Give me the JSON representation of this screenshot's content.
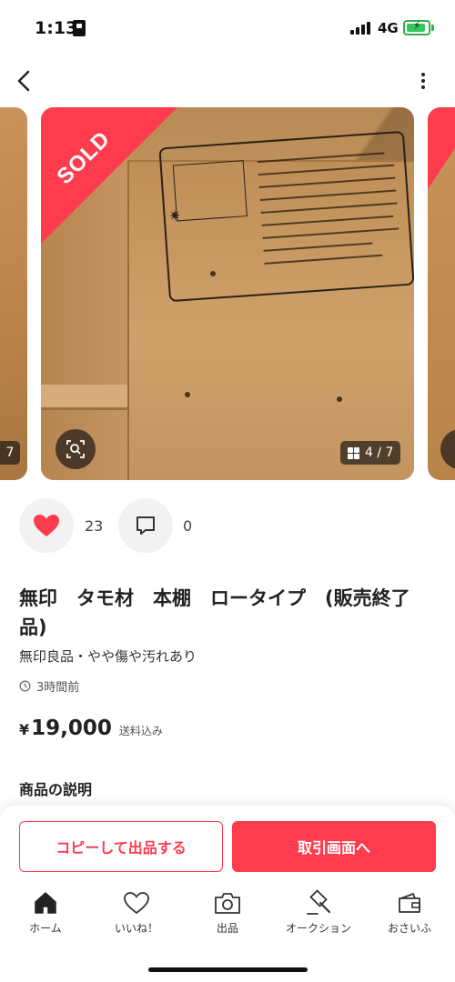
{
  "status_bar": {
    "time": "1:13",
    "network": "4G"
  },
  "nav": {
    "back_icon": "chevron-left-icon",
    "more_icon": "more-vertical-icon"
  },
  "gallery": {
    "sold_label": "SOLD",
    "counter": "4 / 7",
    "prev_counter": "7",
    "zoom_icon": "image-search-icon"
  },
  "actions": {
    "like_count": "23",
    "comment_count": "0",
    "like_color": "#ff3b4e"
  },
  "item": {
    "title": "無印　タモ材　本棚　ロータイプ　(販売終了品)",
    "subtitle": "無印良品・やや傷や汚れあり",
    "posted": "3時間前",
    "price_symbol": "¥",
    "price": "19,000",
    "price_note": "送料込み",
    "description_heading": "商品の説明"
  },
  "buttons": {
    "copy_label": "コピーして出品する",
    "trade_label": "取引画面へ"
  },
  "tabs": [
    {
      "label": "ホーム",
      "icon": "home-icon"
    },
    {
      "label": "いいね！",
      "icon": "heart-outline-icon"
    },
    {
      "label": "出品",
      "icon": "camera-icon"
    },
    {
      "label": "オークション",
      "icon": "gavel-icon"
    },
    {
      "label": "おさいふ",
      "icon": "wallet-icon"
    }
  ],
  "colors": {
    "accent": "#ff3b4e",
    "battery": "#35c759"
  }
}
